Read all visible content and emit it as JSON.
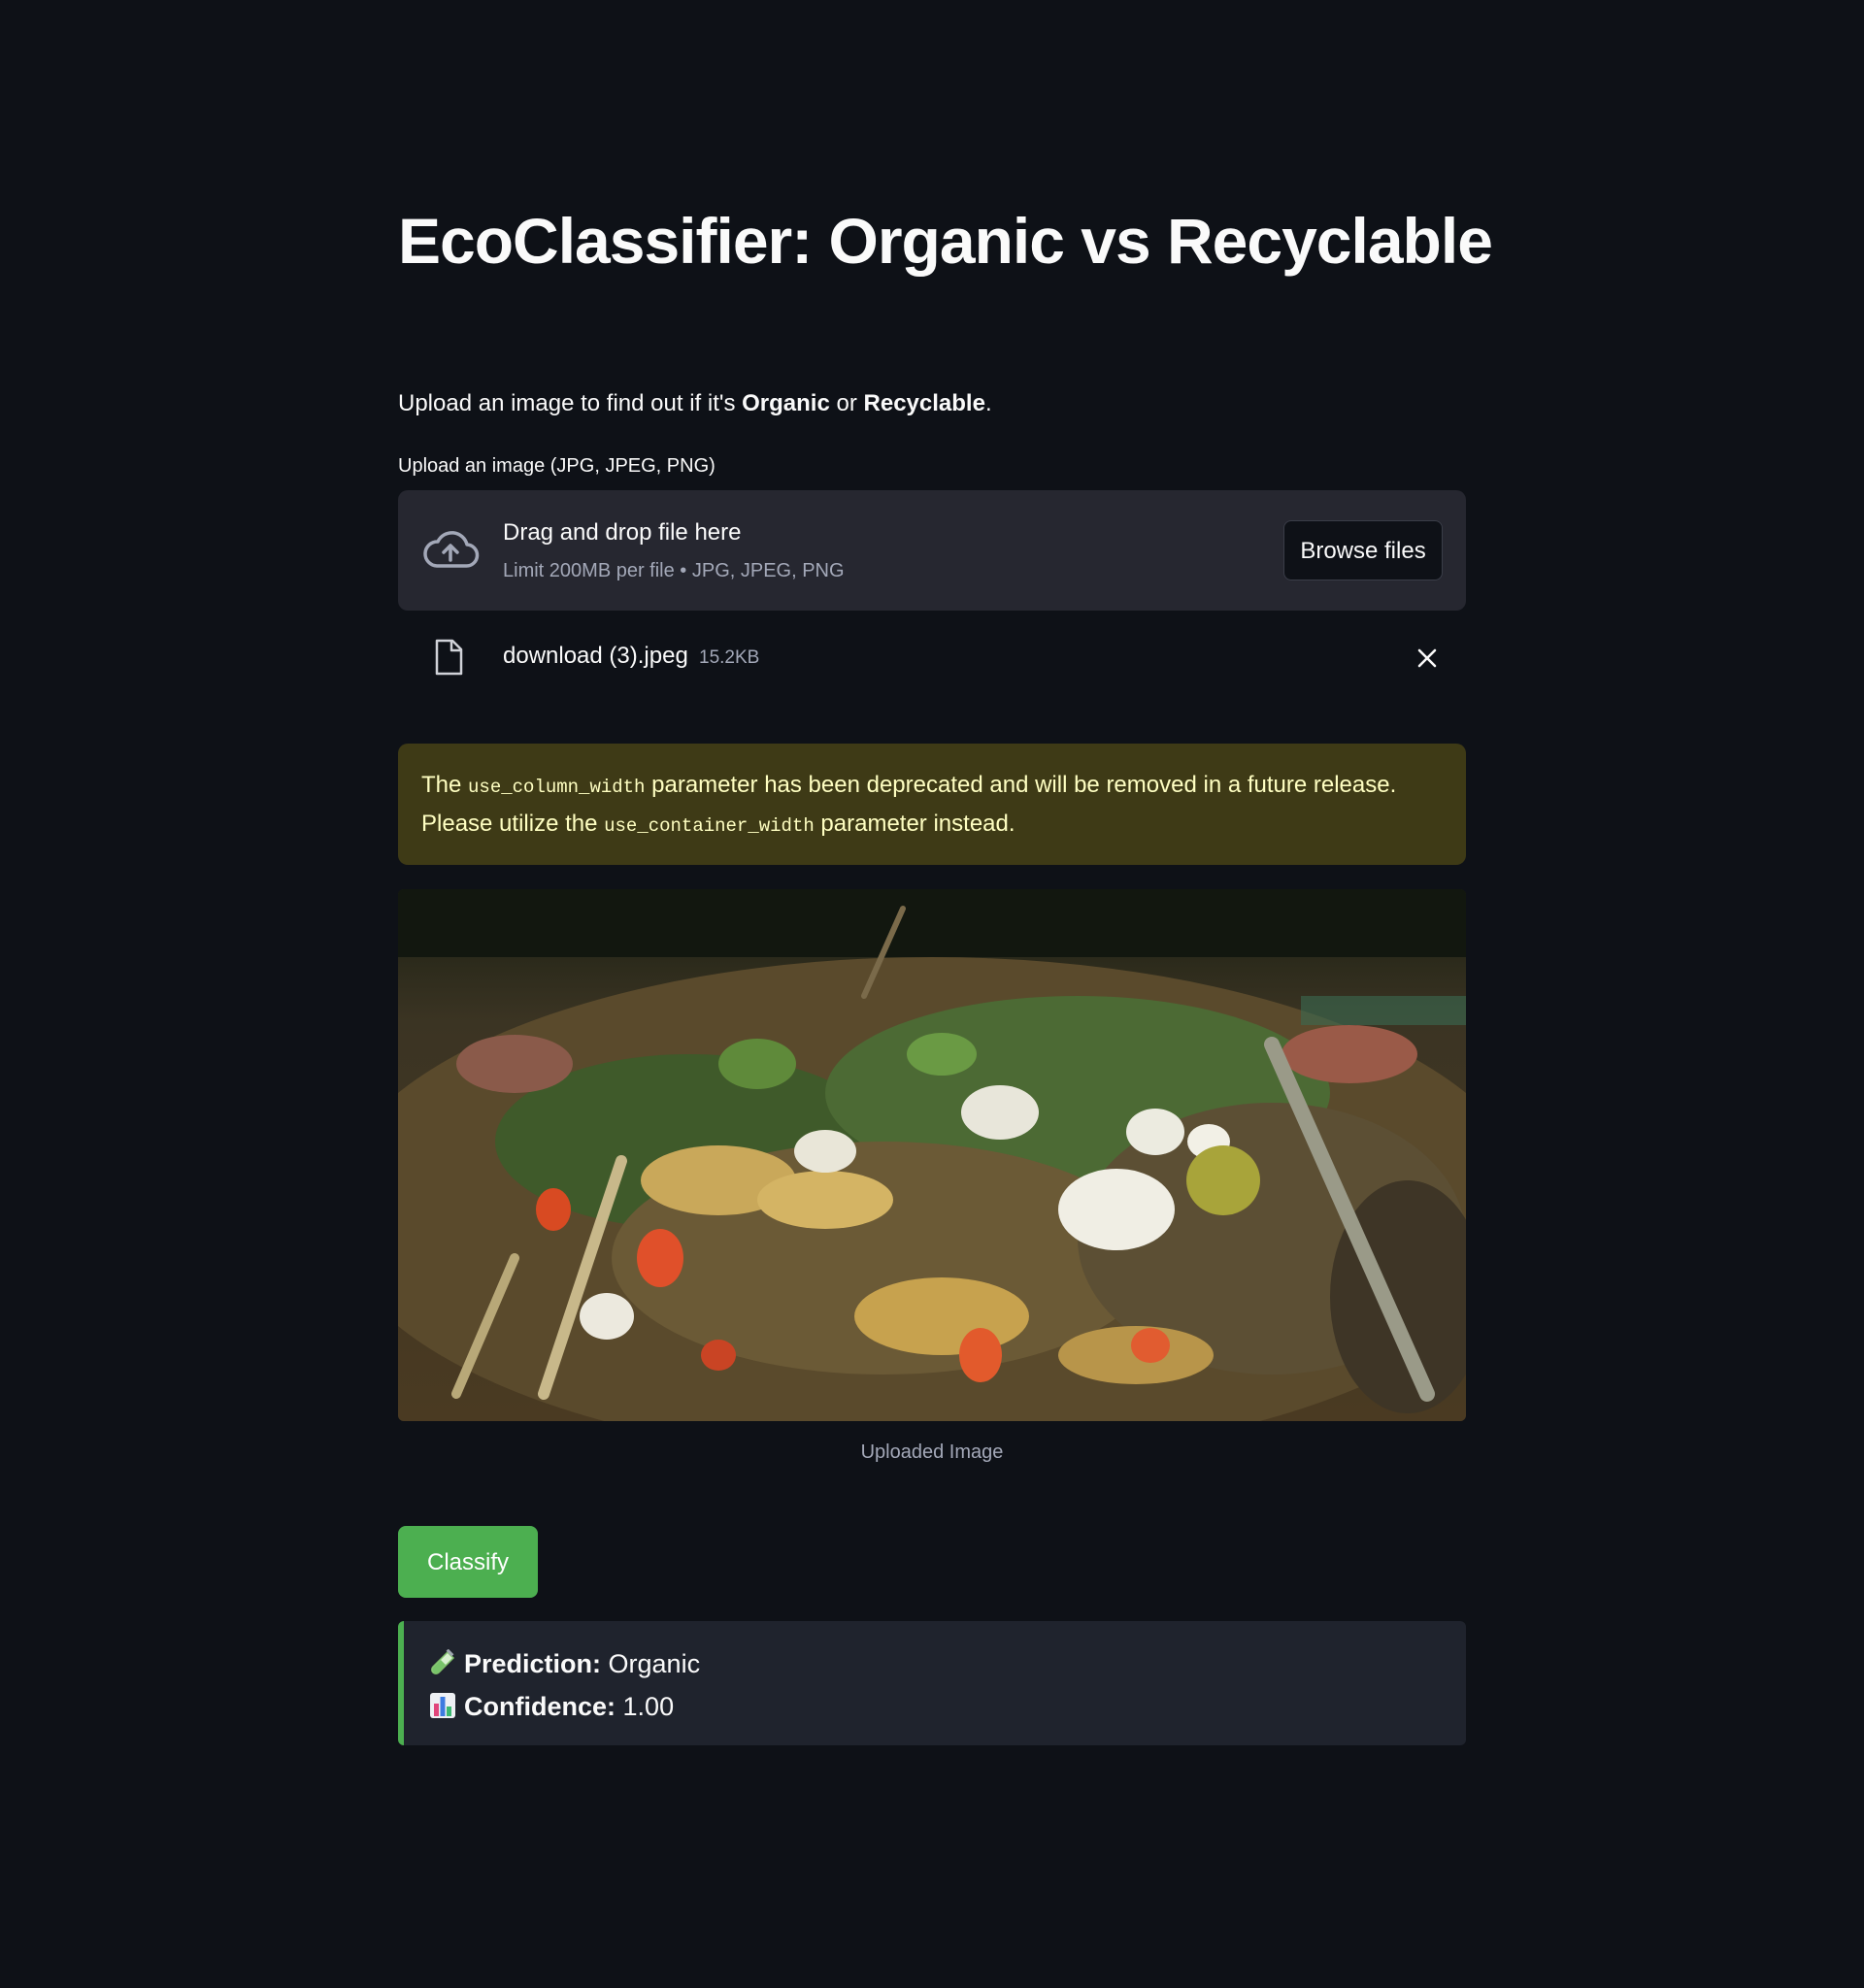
{
  "page": {
    "title": "EcoClassifier: Organic vs Recyclable",
    "intro": {
      "prefix": "Upload an image to find out if it's ",
      "organic": "Organic",
      "middle": " or ",
      "recyclable": "Recyclable",
      "suffix": "."
    }
  },
  "uploader": {
    "label": "Upload an image (JPG, JPEG, PNG)",
    "drop_title": "Drag and drop file here",
    "drop_subtitle": "Limit 200MB per file • JPG, JPEG, PNG",
    "browse_label": "Browse files",
    "icon": "cloud-upload-icon"
  },
  "file": {
    "name": "download (3).jpeg",
    "size": "15.2KB",
    "icon": "file-icon",
    "remove_icon": "close-icon"
  },
  "warning": {
    "text1": "The ",
    "code1": "use_column_width",
    "text2": " parameter has been deprecated and will be removed in a future release. Please utilize the ",
    "code2": "use_container_width",
    "text3": " parameter instead."
  },
  "image": {
    "caption": "Uploaded Image"
  },
  "classify": {
    "label": "Classify"
  },
  "result": {
    "prediction_label": "Prediction:",
    "prediction_value": "Organic",
    "confidence_label": "Confidence:",
    "confidence_value": "1.00",
    "prediction_icon": "test-tube-icon",
    "confidence_icon": "bar-chart-icon"
  },
  "colors": {
    "background": "#0e1117",
    "accent": "#4caf50",
    "warning_bg": "#3e3a16",
    "warning_text": "#ffffc2"
  }
}
